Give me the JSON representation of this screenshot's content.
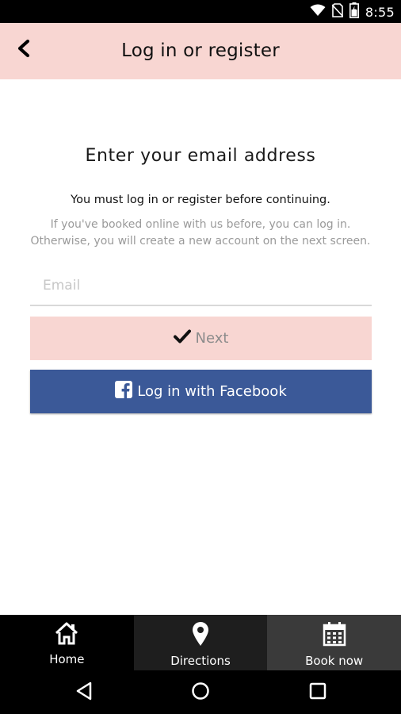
{
  "status_bar": {
    "time": "8:55",
    "icons": [
      "wifi-icon",
      "no-sim-icon",
      "battery-icon"
    ]
  },
  "app_bar": {
    "title": "Log in or register",
    "back_icon": "chevron-left-icon",
    "background": "#f8d6d2"
  },
  "form": {
    "heading": "Enter your email address",
    "must_login": "You must log in or register before continuing.",
    "info": "If you've booked online with us before, you can log in. Otherwise, you will create a new account on the next screen.",
    "email_placeholder": "Email",
    "email_value": "",
    "next_label": "Next",
    "facebook_label": "Log in with Facebook"
  },
  "colors": {
    "accent": "#f8d6d2",
    "facebook": "#3b5998",
    "nav_bg": "#000000"
  },
  "bottom_nav": {
    "items": [
      {
        "label": "Home",
        "icon": "home-icon"
      },
      {
        "label": "Directions",
        "icon": "map-pin-icon"
      },
      {
        "label": "Book now",
        "icon": "calendar-icon"
      }
    ]
  },
  "system_nav": {
    "buttons": [
      "back-triangle-icon",
      "home-circle-icon",
      "recents-square-icon"
    ]
  }
}
